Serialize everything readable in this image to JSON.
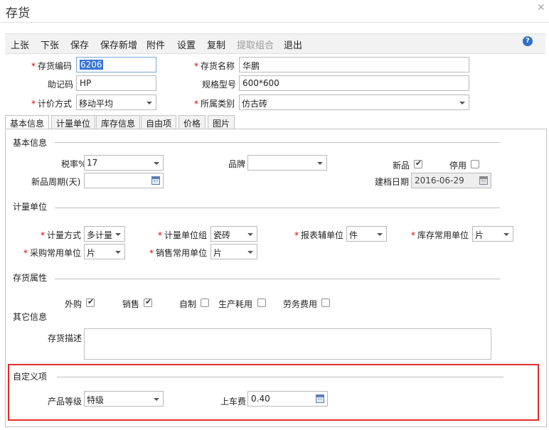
{
  "window": {
    "title": "存货",
    "close_icon": "close-icon"
  },
  "toolbar": {
    "buttons": [
      "上张",
      "下张",
      "保存",
      "保存新增",
      "附件",
      "设置",
      "复制",
      "提取组合",
      "退出"
    ],
    "help_icon": "help-icon",
    "help_glyph": "?"
  },
  "header": {
    "code_label": "存货编码",
    "code_value": "6206",
    "name_label": "存货名称",
    "name_value": "华鹏",
    "mnemonic_label": "助记码",
    "mnemonic_value": "HP",
    "spec_label": "规格型号",
    "spec_value": "600*600",
    "valuation_label": "计价方式",
    "valuation_value": "移动平均",
    "category_label": "所属类别",
    "category_value": "仿古砖"
  },
  "tabs": [
    "基本信息",
    "计量单位",
    "库存信息",
    "自由项",
    "价格",
    "图片"
  ],
  "basic": {
    "section": "基本信息",
    "tax_label": "税率%",
    "tax_value": "17",
    "brand_label": "品牌",
    "brand_value": "",
    "new_label": "新品",
    "new_checked": true,
    "disabled_label": "停用",
    "disabled_checked": false,
    "cycle_label": "新品周期(天)",
    "cycle_value": "",
    "created_label": "建档日期",
    "created_value": "2016-06-29"
  },
  "unit": {
    "section": "计量单位",
    "method_label": "计量方式",
    "method_value": "多计量",
    "group_label": "计量单位组",
    "group_value": "瓷砖",
    "report_label": "报表辅单位",
    "report_value": "件",
    "stock_label": "库存常用单位",
    "stock_value": "片",
    "purchase_label": "采购常用单位",
    "purchase_value": "片",
    "sales_label": "销售常用单位",
    "sales_value": "片"
  },
  "attrs": {
    "section": "存货属性",
    "items": [
      {
        "label": "外购",
        "checked": true
      },
      {
        "label": "销售",
        "checked": true
      },
      {
        "label": "自制",
        "checked": false
      },
      {
        "label": "生产耗用",
        "checked": false
      },
      {
        "label": "劳务费用",
        "checked": false
      }
    ]
  },
  "other": {
    "section": "其它信息",
    "desc_label": "存货描述",
    "desc_value": ""
  },
  "custom": {
    "section": "自定义项",
    "grade_label": "产品等级",
    "grade_value": "特级",
    "fee_label": "上车费",
    "fee_value": "0.40"
  },
  "colors": {
    "highlight_border": "#e12b2b",
    "required": "#d60000",
    "help": "#2f6fc6"
  }
}
